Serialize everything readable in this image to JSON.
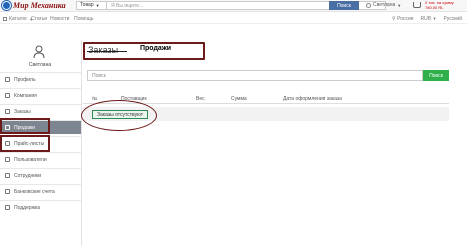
{
  "header": {
    "logo_text": "Мир Механика",
    "category_select": "Товар",
    "search_placeholder": "Я Вы ищите...",
    "search_button": "Поиск",
    "user_name": "Светлана",
    "cart_count": "0 тов. на сумму",
    "cart_sum": "780.00 RL"
  },
  "nav": {
    "catalog": "Каталог",
    "articles": "Статьи",
    "news": "Новости",
    "help": "Помощь",
    "region": "Россия",
    "currency": "RUB",
    "language": "Русский"
  },
  "sidebar": {
    "user_name": "Светлана",
    "items": [
      {
        "label": "Профиль",
        "icon": "user-icon",
        "active": false
      },
      {
        "label": "Компания",
        "icon": "building-icon",
        "active": false
      },
      {
        "label": "Заказы",
        "icon": "box-icon",
        "active": false
      },
      {
        "label": "Продажи",
        "icon": "bag-icon",
        "active": true
      },
      {
        "label": "Прайс-листы",
        "icon": "list-icon",
        "active": false
      },
      {
        "label": "Пользователи",
        "icon": "users-icon",
        "active": false
      },
      {
        "label": "Сотрудники",
        "icon": "id-card-icon",
        "active": false
      },
      {
        "label": "Банковские счета",
        "icon": "bank-icon",
        "active": false
      },
      {
        "label": "Поддержка",
        "icon": "chat-icon",
        "active": false
      }
    ]
  },
  "main": {
    "tabs": [
      {
        "label": "Заказы",
        "crossed_out": true
      },
      {
        "label": "Продажи",
        "active": true
      }
    ],
    "filter_placeholder": "Поиск",
    "filter_button": "Поиск",
    "columns": [
      "№",
      "Поставщик",
      "Вес",
      "Сумма",
      "Дата оформления заказа"
    ],
    "empty_message": "Заказы отсутствуют"
  },
  "colors": {
    "annotation": "#6d1a1a",
    "search_button": "#4a6fa5",
    "filter_button": "#2fb04b",
    "active_item": "#7d8590"
  }
}
